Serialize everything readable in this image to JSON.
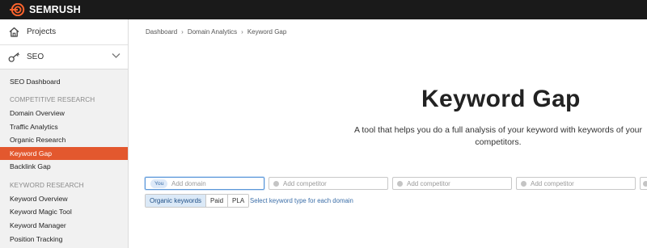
{
  "brand": {
    "name": "SEMRUSH",
    "color": "#ff642d"
  },
  "sidebar": {
    "projects_label": "Projects",
    "projects_icon": "home-icon",
    "seo_label": "SEO",
    "seo_icon": "key-icon",
    "items": [
      {
        "type": "item",
        "label": "SEO Dashboard"
      },
      {
        "type": "heading",
        "label": "COMPETITIVE RESEARCH"
      },
      {
        "type": "item",
        "label": "Domain Overview"
      },
      {
        "type": "item",
        "label": "Traffic Analytics"
      },
      {
        "type": "item",
        "label": "Organic Research"
      },
      {
        "type": "item",
        "label": "Keyword Gap",
        "active": true
      },
      {
        "type": "item",
        "label": "Backlink Gap"
      },
      {
        "type": "heading",
        "label": "KEYWORD RESEARCH"
      },
      {
        "type": "item",
        "label": "Keyword Overview"
      },
      {
        "type": "item",
        "label": "Keyword Magic Tool"
      },
      {
        "type": "item",
        "label": "Keyword Manager"
      },
      {
        "type": "item",
        "label": "Position Tracking"
      }
    ],
    "active_color": "#e3582e"
  },
  "breadcrumb": [
    "Dashboard",
    "Domain Analytics",
    "Keyword Gap"
  ],
  "main": {
    "title": "Keyword Gap",
    "description_line1": "A tool that helps you do a full analysis of your keyword with keywords of your",
    "description_line2": "competitors.",
    "you_badge": "You",
    "domain_placeholder": "Add domain",
    "competitor_placeholder": "Add competitor",
    "keyword_types": [
      "Organic keywords",
      "Paid",
      "PLA"
    ],
    "selected_keyword_type": "Organic keywords",
    "keyword_type_link": "Select keyword type for each domain"
  }
}
